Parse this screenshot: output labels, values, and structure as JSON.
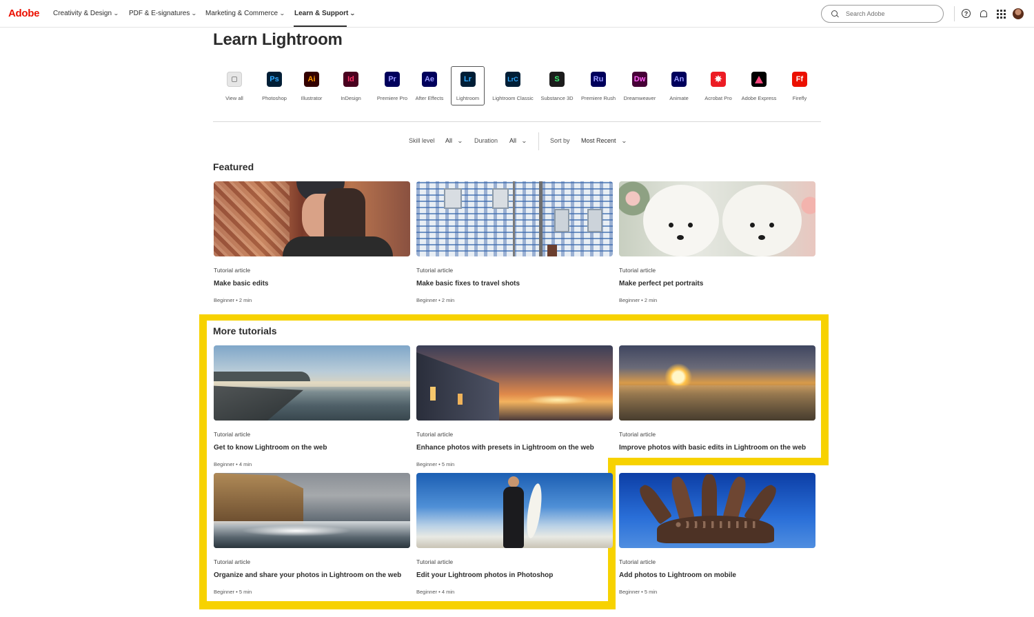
{
  "header": {
    "logo": "Adobe",
    "nav": [
      {
        "label": "Creativity & Design"
      },
      {
        "label": "PDF & E-signatures"
      },
      {
        "label": "Marketing & Commerce"
      },
      {
        "label": "Learn & Support"
      }
    ],
    "search_placeholder": "Search Adobe",
    "help_glyph": "?"
  },
  "page": {
    "title": "Learn Lightroom"
  },
  "products": [
    {
      "label": "View all",
      "abbr": "",
      "icon": "view-all-icon"
    },
    {
      "label": "Photoshop",
      "abbr": "Ps",
      "icon": "photoshop-icon",
      "bg": "#001e36",
      "fg": "#31a8ff"
    },
    {
      "label": "Illustrator",
      "abbr": "Ai",
      "icon": "illustrator-icon",
      "bg": "#330000",
      "fg": "#ff9a00"
    },
    {
      "label": "InDesign",
      "abbr": "Id",
      "icon": "indesign-icon",
      "bg": "#49021f",
      "fg": "#ff3366"
    },
    {
      "label": "Premiere Pro",
      "abbr": "Pr",
      "icon": "premiere-pro-icon",
      "bg": "#00005b",
      "fg": "#9999ff"
    },
    {
      "label": "After Effects",
      "abbr": "Ae",
      "icon": "after-effects-icon",
      "bg": "#00005b",
      "fg": "#9999ff"
    },
    {
      "label": "Lightroom",
      "abbr": "Lr",
      "icon": "lightroom-icon",
      "bg": "#001e36",
      "fg": "#31a8ff"
    },
    {
      "label": "Lightroom Classic",
      "abbr": "LrC",
      "icon": "lightroom-classic-icon",
      "bg": "#001e36",
      "fg": "#31a8ff"
    },
    {
      "label": "Substance 3D",
      "abbr": "S",
      "icon": "substance-3d-icon",
      "bg": "#1c1c1c",
      "fg": "#3df074"
    },
    {
      "label": "Premiere Rush",
      "abbr": "Ru",
      "icon": "premiere-rush-icon",
      "bg": "#00005b",
      "fg": "#9999ff"
    },
    {
      "label": "Dreamweaver",
      "abbr": "Dw",
      "icon": "dreamweaver-icon",
      "bg": "#470137",
      "fg": "#ff61f6"
    },
    {
      "label": "Animate",
      "abbr": "An",
      "icon": "animate-icon",
      "bg": "#00005b",
      "fg": "#9999ff"
    },
    {
      "label": "Acrobat Pro",
      "abbr": "",
      "icon": "acrobat-pro-icon",
      "bg": "#ec1c24",
      "fg": "#ffffff"
    },
    {
      "label": "Adobe Express",
      "abbr": "",
      "icon": "adobe-express-icon",
      "bg": "#000000",
      "fg": "#ff477e"
    },
    {
      "label": "Firefly",
      "abbr": "Ff",
      "icon": "firefly-icon",
      "bg": "#eb1000",
      "fg": "#ffffff"
    }
  ],
  "filters": {
    "skill_label": "Skill level",
    "skill_value": "All",
    "duration_label": "Duration",
    "duration_value": "All",
    "sort_label": "Sort by",
    "sort_value": "Most Recent"
  },
  "featured": {
    "heading": "Featured",
    "cards": [
      {
        "type": "Tutorial article",
        "title": "Make basic edits",
        "meta": "Beginner • 2 min"
      },
      {
        "type": "Tutorial article",
        "title": "Make basic fixes to travel shots",
        "meta": "Beginner • 2 min"
      },
      {
        "type": "Tutorial article",
        "title": "Make perfect pet portraits",
        "meta": "Beginner • 2 min"
      }
    ]
  },
  "more": {
    "heading": "More tutorials",
    "cards": [
      {
        "type": "Tutorial article",
        "title": "Get to know Lightroom on the web",
        "meta": "Beginner • 4 min"
      },
      {
        "type": "Tutorial article",
        "title": "Enhance photos with presets in Lightroom on the web",
        "meta": "Beginner • 5 min"
      },
      {
        "type": "Tutorial article",
        "title": "Improve photos with basic edits in Lightroom on the web",
        "meta": ""
      },
      {
        "type": "Tutorial article",
        "title": "Organize and share your photos in Lightroom on the web",
        "meta": "Beginner • 5 min"
      },
      {
        "type": "Tutorial article",
        "title": "Edit your Lightroom photos in Photoshop",
        "meta": "Beginner • 4 min"
      },
      {
        "type": "Tutorial article",
        "title": "Add photos to Lightroom on mobile",
        "meta": "Beginner • 5 min"
      }
    ]
  },
  "colors": {
    "highlight": "#f7d200",
    "brand": "#eb1000"
  }
}
